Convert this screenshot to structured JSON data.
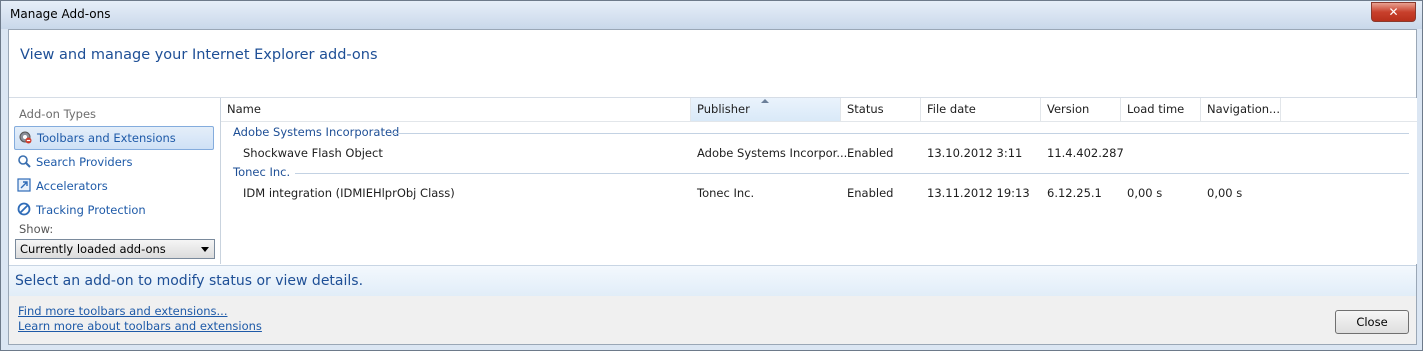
{
  "window": {
    "title": "Manage Add-ons",
    "close_glyph": "✕"
  },
  "header": {
    "heading": "View and manage your Internet Explorer add-ons"
  },
  "sidebar": {
    "addon_types_label": "Add-on Types",
    "items": [
      {
        "label": "Toolbars and Extensions",
        "icon": "gear-icon",
        "selected": true
      },
      {
        "label": "Search Providers",
        "icon": "search-icon",
        "selected": false
      },
      {
        "label": "Accelerators",
        "icon": "accelerator-icon",
        "selected": false
      },
      {
        "label": "Tracking Protection",
        "icon": "block-icon",
        "selected": false
      }
    ],
    "show_label": "Show:",
    "show_value": "Currently loaded add-ons"
  },
  "table": {
    "columns": [
      "Name",
      "Publisher",
      "Status",
      "File date",
      "Version",
      "Load time",
      "Navigation..."
    ],
    "groups": [
      {
        "name": "Adobe Systems Incorporated",
        "rows": [
          {
            "name": "Shockwave Flash Object",
            "publisher": "Adobe Systems Incorpor...",
            "status": "Enabled",
            "file_date": "13.10.2012 3:11",
            "version": "11.4.402.287",
            "load_time": "",
            "navigation": ""
          }
        ]
      },
      {
        "name": "Tonec Inc.",
        "rows": [
          {
            "name": "IDM integration (IDMIEHlprObj Class)",
            "publisher": "Tonec Inc.",
            "status": "Enabled",
            "file_date": "13.11.2012 19:13",
            "version": "6.12.25.1",
            "load_time": "0,00 s",
            "navigation": "0,00 s"
          }
        ]
      }
    ]
  },
  "status": {
    "text": "Select an add-on to modify status or view details."
  },
  "footer": {
    "link1": "Find more toolbars and extensions...",
    "link2": "Learn more about toolbars and extensions",
    "close_label": "Close"
  }
}
